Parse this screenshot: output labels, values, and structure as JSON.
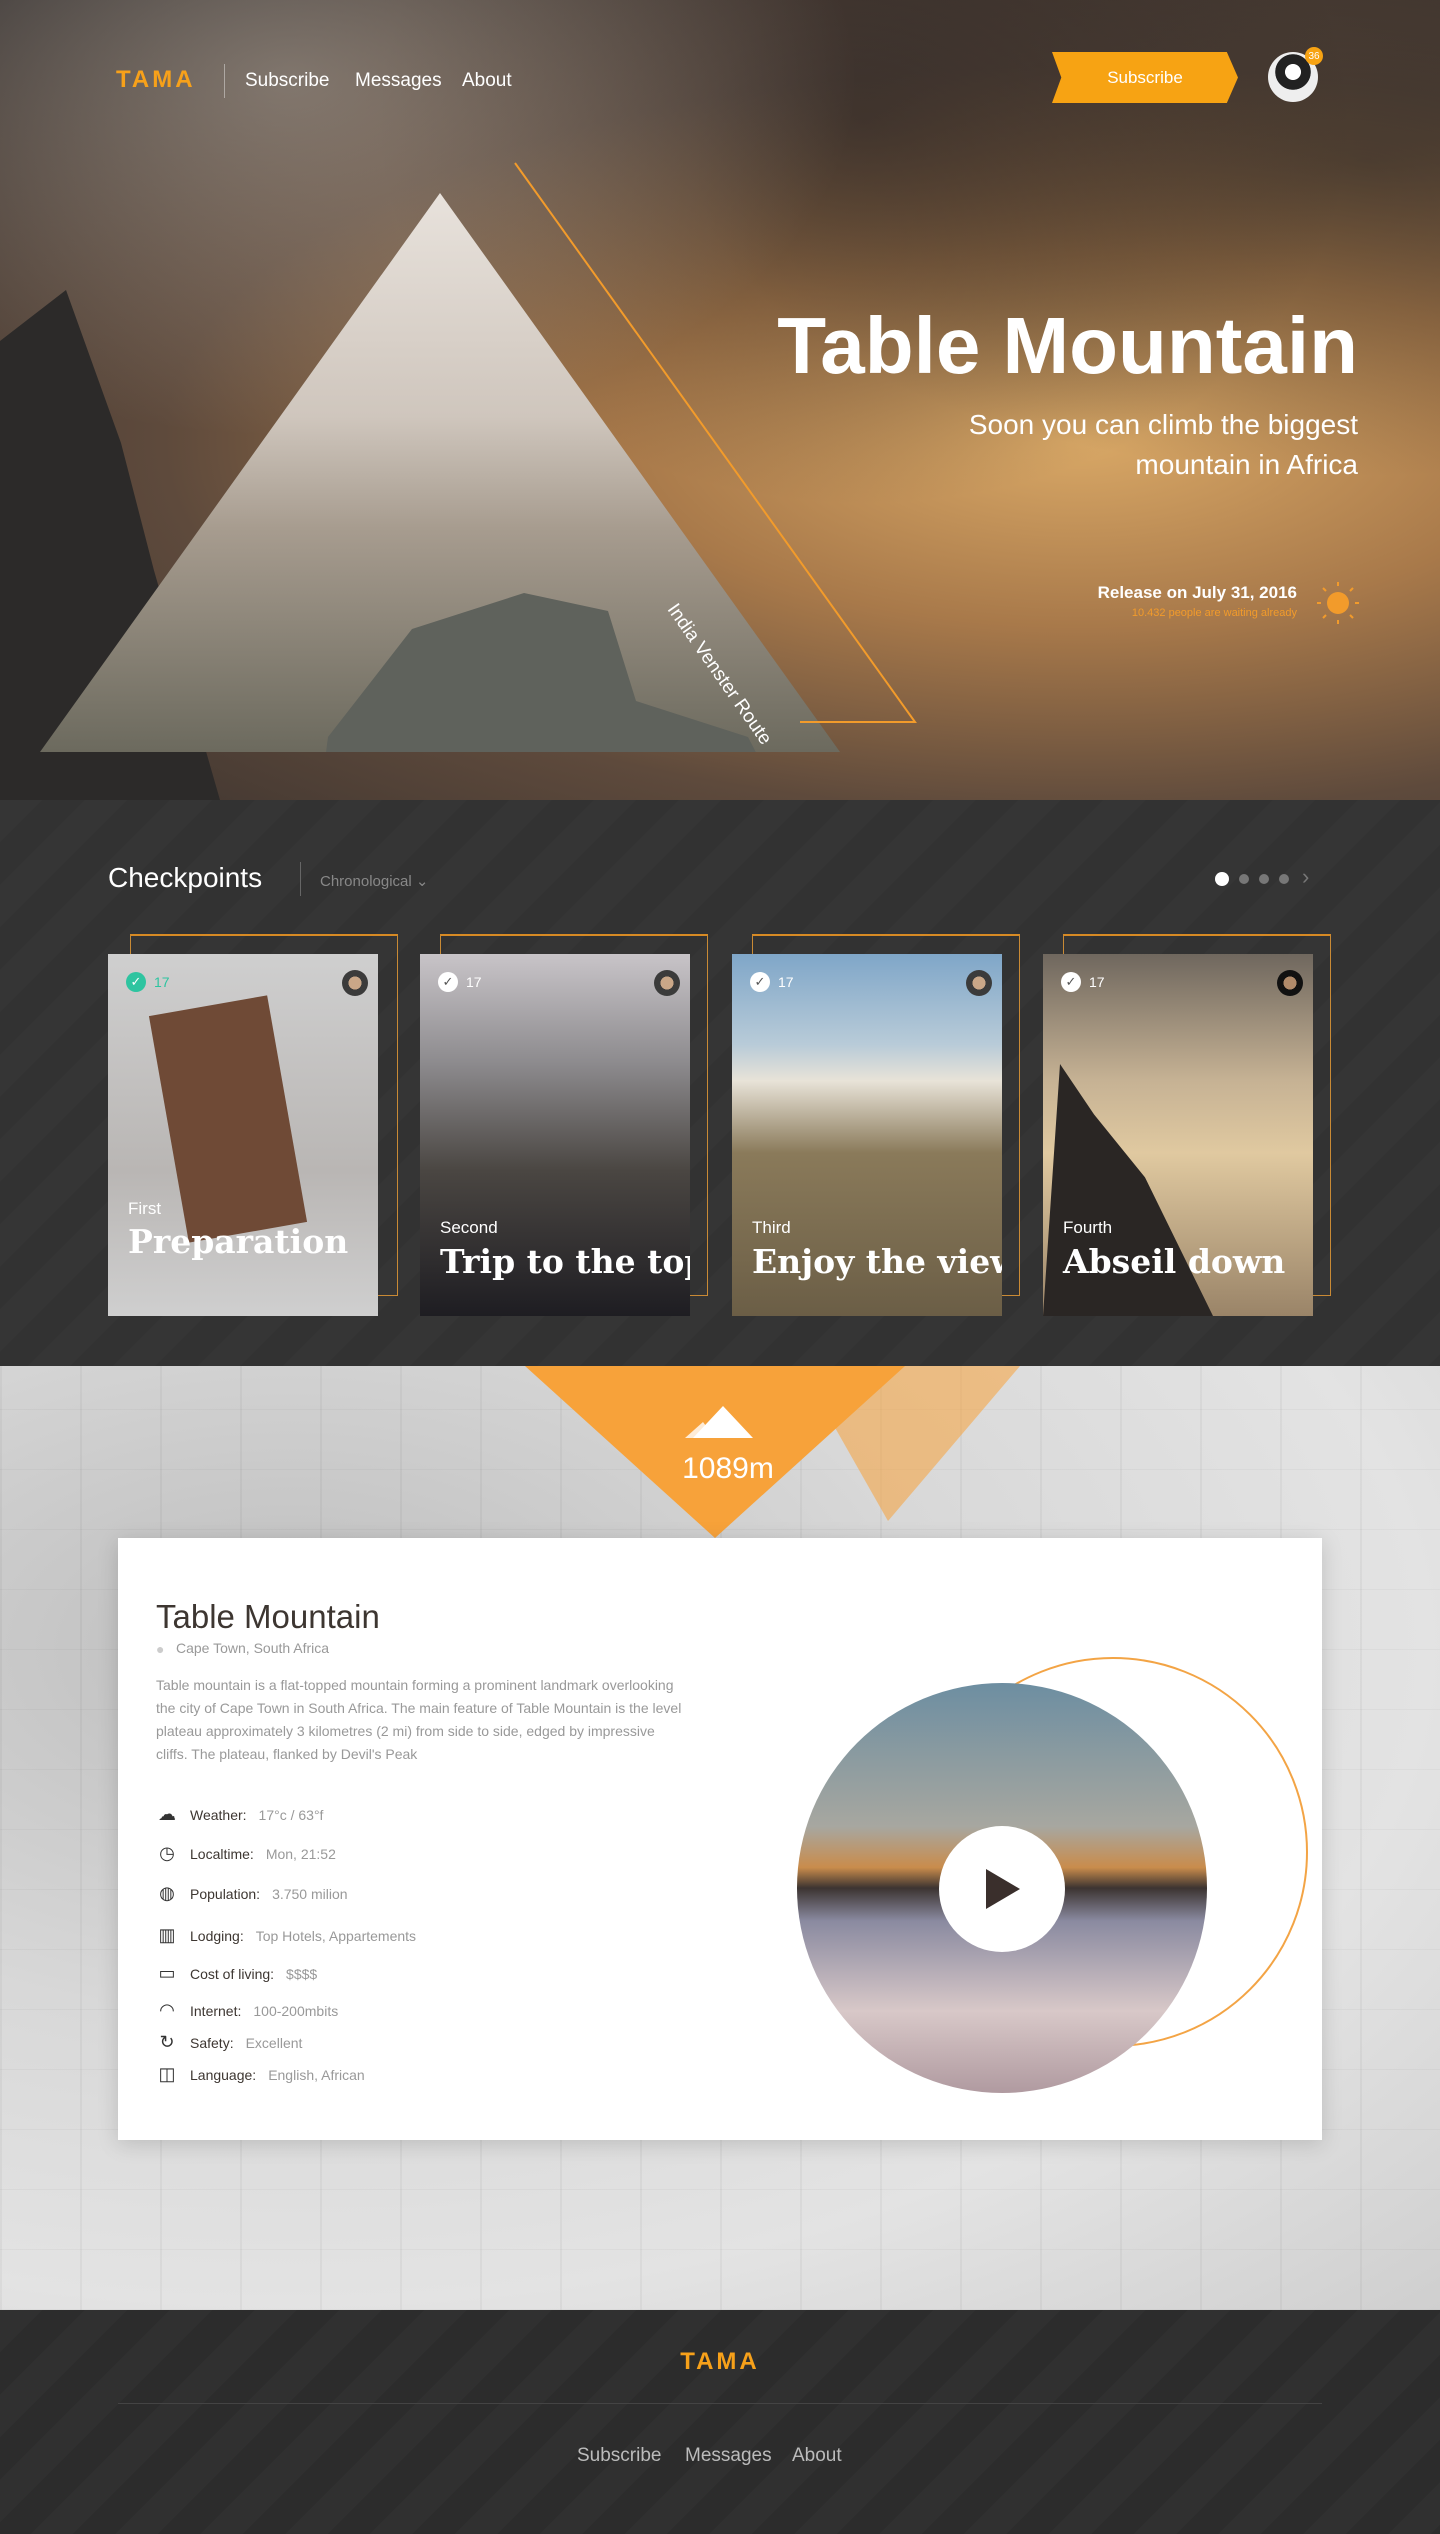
{
  "nav": {
    "logo": "TAMA",
    "links": [
      "Subscribe",
      "Messages",
      "About"
    ],
    "subscribe_button": "Subscribe",
    "notification_count": "36"
  },
  "hero": {
    "title": "Table Mountain",
    "subtitle_line1": "Soon you can climb the biggest",
    "subtitle_line2": "mountain in Africa",
    "route": "India Venster Route",
    "release": "Release on July 31, 2016",
    "waiting": "10.432 people are waiting already"
  },
  "checkpoints": {
    "title": "Checkpoints",
    "sort": "Chronological ⌄",
    "next": "›",
    "cards": [
      {
        "order": "First",
        "title": "Preparation",
        "count": "17"
      },
      {
        "order": "Second",
        "title": "Trip to the top",
        "count": "17"
      },
      {
        "order": "Third",
        "title": "Enjoy the view",
        "count": "17"
      },
      {
        "order": "Fourth",
        "title": "Abseil down",
        "count": "17"
      }
    ]
  },
  "altitude": "1089m",
  "info": {
    "title": "Table Mountain",
    "location": "Cape Town, South Africa",
    "description": "Table mountain is a flat-topped mountain forming a prominent landmark overlooking the city of Cape Town in South Africa. The main feature of Table Mountain is the level plateau approximately 3 kilometres (2 mi) from side to side, edged by impressive cliffs. The plateau, flanked by Devil's Peak",
    "facts": [
      {
        "label": "Weather:",
        "value": "17°c / 63°f",
        "icon": "☁"
      },
      {
        "label": "Localtime:",
        "value": "Mon, 21:52",
        "icon": "◷"
      },
      {
        "label": "Population:",
        "value": "3.750 milion",
        "icon": "◍"
      },
      {
        "label": "Lodging:",
        "value": "Top Hotels, Appartements",
        "icon": "▥"
      },
      {
        "label": "Cost of living:",
        "value": "$$$$",
        "icon": "▭"
      },
      {
        "label": "Internet:",
        "value": "100-200mbits",
        "icon": "◠"
      },
      {
        "label": "Safety:",
        "value": "Excellent",
        "icon": "↻"
      },
      {
        "label": "Language:",
        "value": "English, African",
        "icon": "◫"
      }
    ]
  },
  "footer": {
    "logo": "TAMA",
    "links": [
      "Subscribe",
      "Messages",
      "About"
    ]
  },
  "colors": {
    "accent": "#f7a313",
    "dark": "#333333"
  }
}
